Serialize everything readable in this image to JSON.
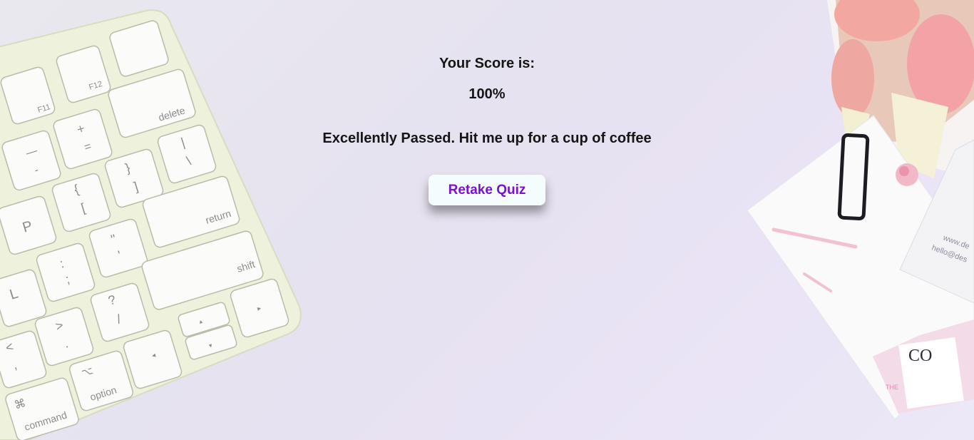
{
  "quiz": {
    "score_title": "Your Score is:",
    "score_value": "100%",
    "result_message": "Excellently Passed. Hit me up for a cup of coffee",
    "retake_label": "Retake Quiz"
  },
  "background": {
    "keyboard_keys": [
      "F11",
      "F12",
      "delete",
      "+",
      "=",
      "—",
      "-",
      "}",
      "]",
      "{",
      "[",
      "|",
      "\\",
      "P",
      "\"",
      "'",
      "return",
      ":",
      ";",
      "L",
      "?",
      "/",
      "shift",
      ">",
      ".",
      "<",
      ",",
      "⌥",
      "option",
      "⌘",
      "command"
    ],
    "card_text": [
      "www.de",
      "hello@des",
      "CO",
      "THE"
    ]
  },
  "colors": {
    "button_text": "#7a10d4",
    "button_bg": "#f5fcfd",
    "text": "#151515"
  }
}
